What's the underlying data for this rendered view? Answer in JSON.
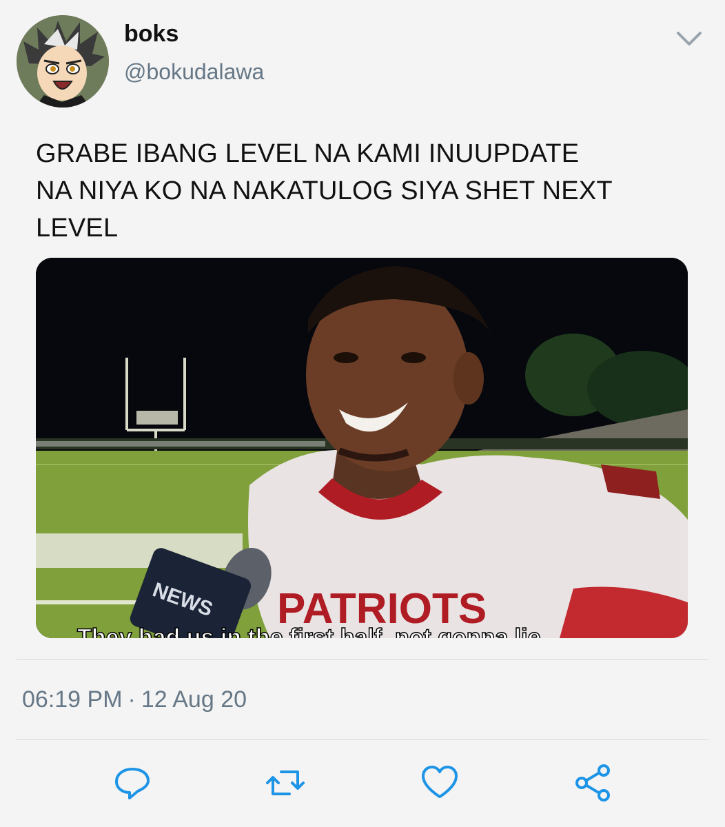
{
  "tweet": {
    "author": {
      "display_name": "boks",
      "handle": "@bokudalawa",
      "avatar_icon": "anime-character-avatar"
    },
    "menu_icon": "chevron-down-icon",
    "text_lines": [
      "GRABE IBANG LEVEL NA KAMI INUUPDATE",
      "NA NIYA KO NA NAKATULOG SIYA SHET NEXT",
      "LEVEL"
    ],
    "media": {
      "microphone_label": "NEWS",
      "jersey_text": "PATRIOTS",
      "caption": "They had us in the first half, not gonna lie"
    },
    "time": "06:19 PM",
    "date": "12 Aug 20",
    "actions": [
      {
        "icon": "reply-icon"
      },
      {
        "icon": "retweet-icon"
      },
      {
        "icon": "like-icon"
      },
      {
        "icon": "share-icon"
      }
    ],
    "colors": {
      "secondary_text": "#657786",
      "icon": "#1d94e6",
      "background": "#f4f4f4"
    }
  }
}
